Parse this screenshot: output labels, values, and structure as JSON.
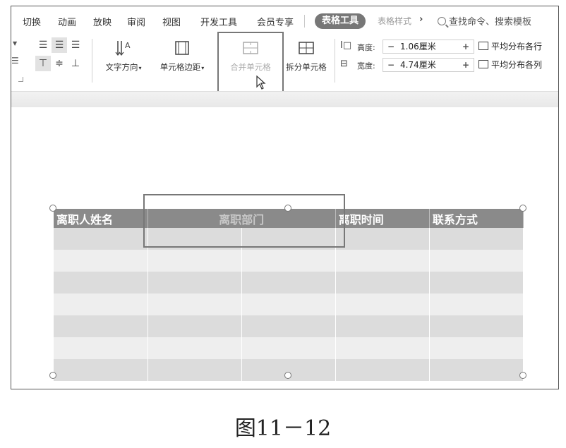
{
  "tabs": [
    "切换",
    "动画",
    "放映",
    "审阅",
    "视图",
    "开发工具",
    "会员专享"
  ],
  "active_tab": "表格工具",
  "next_tab": "表格样式",
  "search_placeholder": "查找命令、搜索模板",
  "ribbon": {
    "text_direction": "文字方向",
    "cell_margin": "单元格边距",
    "merge_cells": "合并单元格",
    "split_cells": "拆分单元格",
    "height_label": "高度:",
    "height_value": "1.06厘米",
    "width_label": "宽度:",
    "width_value": "4.74厘米",
    "distribute_rows": "平均分布各行",
    "distribute_cols": "平均分布各列"
  },
  "table": {
    "headers": [
      "离职人姓名",
      "离职部门",
      "离职时间",
      "联系方式"
    ],
    "row_count": 7
  },
  "caption": "图11－12",
  "colors": {
    "header_bg": "#8a8a8a",
    "row_dark": "#dcdcdc",
    "row_light": "#eeeeee",
    "highlight": "#777777"
  }
}
